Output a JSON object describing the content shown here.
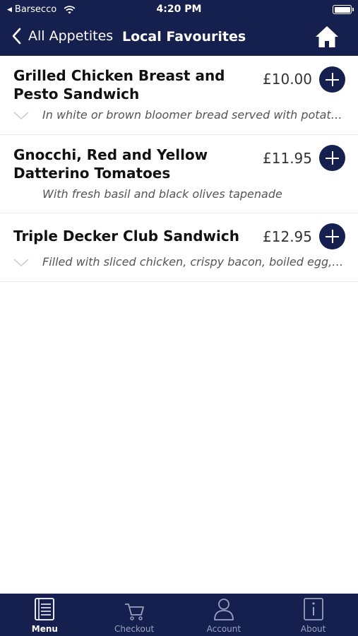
{
  "status_bar": {
    "back_app": "Barsecco",
    "time": "4:20 PM"
  },
  "nav": {
    "back_label": "All Appetites",
    "title": "Local Favourites"
  },
  "items": [
    {
      "name": "Grilled Chicken Breast and Pesto Sandwich",
      "price": "£10.00",
      "description": "In white or brown bloomer bread served with potato crisps",
      "expandable": true
    },
    {
      "name": "Gnocchi, Red and Yellow Datterino Tomatoes",
      "price": "£11.95",
      "description": "With fresh basil and black olives tapenade",
      "expandable": false
    },
    {
      "name": "Triple Decker Club Sandwich",
      "price": "£12.95",
      "description": "Filled with sliced chicken, crispy bacon, boiled egg, lettuce and tomato",
      "expandable": true
    }
  ],
  "tabs": [
    {
      "label": "Menu",
      "icon": "menu-book-icon",
      "active": true
    },
    {
      "label": "Checkout",
      "icon": "cart-icon",
      "active": false
    },
    {
      "label": "Account",
      "icon": "person-icon",
      "active": false
    },
    {
      "label": "About",
      "icon": "info-icon",
      "active": false
    }
  ],
  "colors": {
    "brand": "#16204e",
    "background": "#ffffff",
    "tab_inactive": "#9aa0bd"
  }
}
